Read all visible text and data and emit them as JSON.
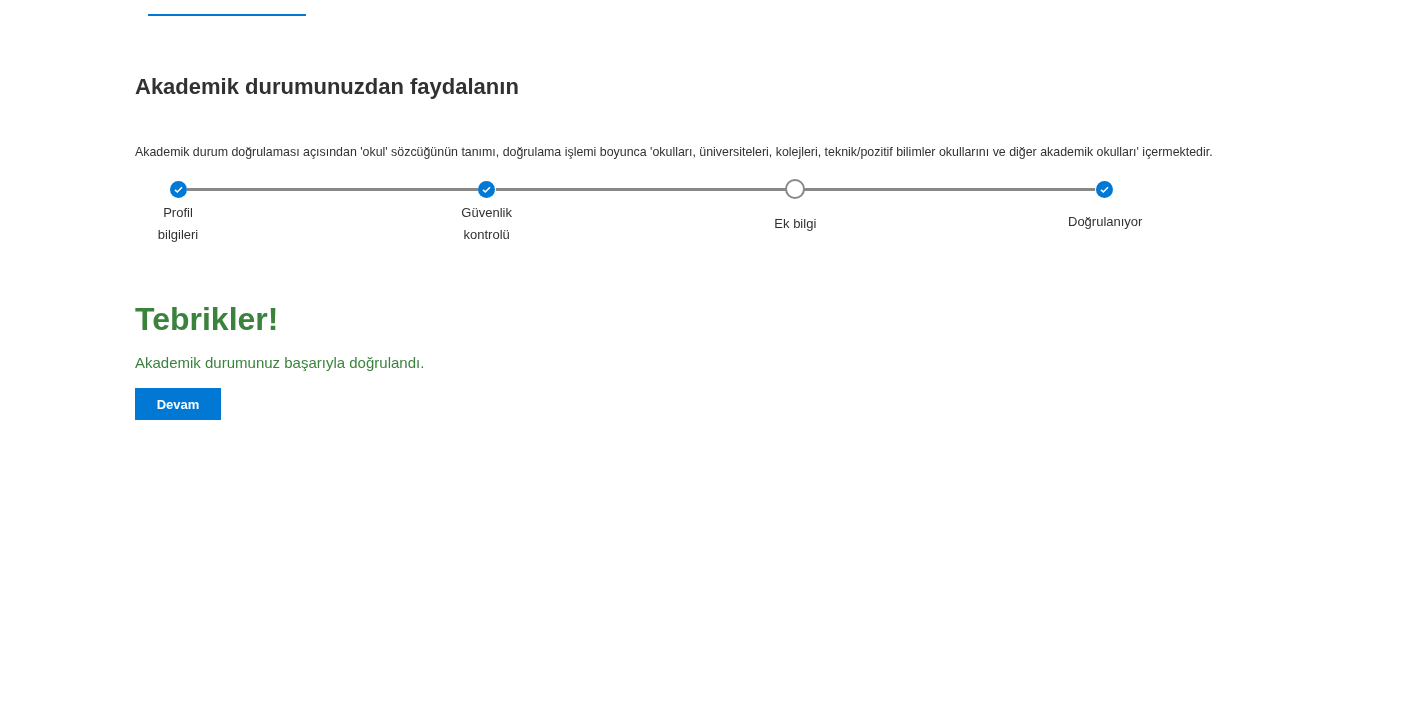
{
  "tabs": [
    {
      "selected": true
    }
  ],
  "heading": "Akademik durumunuzdan faydalanın",
  "description": "Akademik durum doğrulaması açısından 'okul' sözcüğünün tanımı, doğrulama işlemi boyunca 'okulları, üniversiteleri, kolejleri, teknik/pozitif bilimler okullarını ve diğer akademik okulları' içermektedir.",
  "steps": [
    {
      "label": "Profil bilgileri",
      "completed": true
    },
    {
      "label": "Güvenlik kontrolü",
      "completed": true
    },
    {
      "label": "Ek bilgi",
      "completed": false
    },
    {
      "label": "Doğrulanıyor",
      "completed": true
    }
  ],
  "success": {
    "title": "Tebrikler!",
    "message": "Akademik durumunuz başarıyla doğrulandı."
  },
  "button": "Devam"
}
